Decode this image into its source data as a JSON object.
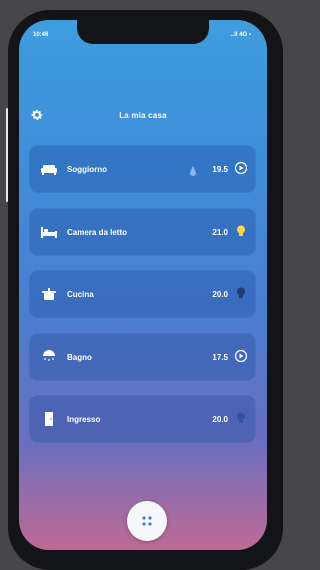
{
  "status": {
    "time": "10:46",
    "signal": "..ll 4G ▪"
  },
  "header": {
    "title": "La mia casa",
    "settings_icon": "gear-icon"
  },
  "rooms": [
    {
      "name": "Soggiorno",
      "temp": "19.5",
      "icon": "sofa-icon",
      "status_icon": "play-circle-icon",
      "extra_icon": "drop-icon"
    },
    {
      "name": "Camera da letto",
      "temp": "21.0",
      "icon": "bed-icon",
      "status_icon": "bulb-icon"
    },
    {
      "name": "Cucina",
      "temp": "20.0",
      "icon": "pot-icon",
      "status_icon": "bulb-off-icon"
    },
    {
      "name": "Bagno",
      "temp": "17.5",
      "icon": "shower-icon",
      "status_icon": "play-circle-icon"
    },
    {
      "name": "Ingresso",
      "temp": "20.0",
      "icon": "door-icon",
      "status_icon": "bulb-off-icon"
    }
  ],
  "colors": {
    "bulb_on": "#ffd84a",
    "bulb_off": "#1f3d7a",
    "button_bg": "#f6f7fb"
  }
}
